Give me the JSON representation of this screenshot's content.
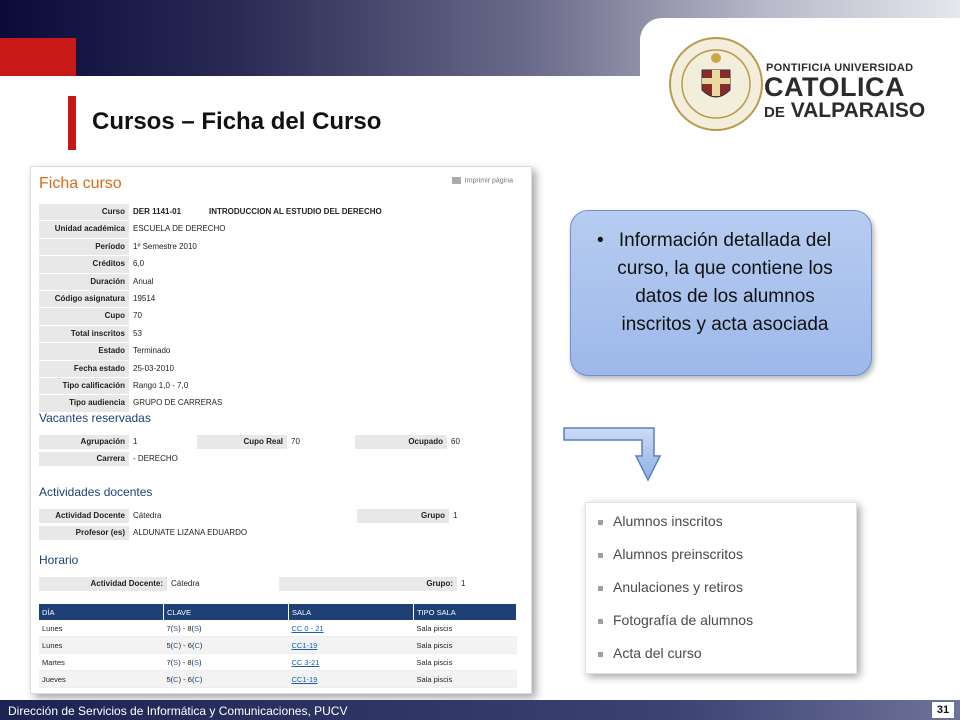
{
  "slide": {
    "title": "Cursos – Ficha del Curso",
    "university": {
      "l1": "PONTIFICIA UNIVERSIDAD",
      "l2": "CATOLICA",
      "l3a": "DE",
      "l3b": "VALPARAISO"
    },
    "footer": "Dirección de Servicios de Informática y Comunicaciones, PUCV",
    "page": "31"
  },
  "ficha": {
    "title": "Ficha curso",
    "print": "Imprimir página",
    "rows": [
      {
        "label": "Curso",
        "value": "DER 1141-01",
        "value2": "INTRODUCCION AL ESTUDIO DEL DERECHO"
      },
      {
        "label": "Unidad académica",
        "value": "ESCUELA DE DERECHO"
      },
      {
        "label": "Período",
        "value": "1º Semestre 2010"
      },
      {
        "label": "Créditos",
        "value": "6,0"
      },
      {
        "label": "Duración",
        "value": "Anual"
      },
      {
        "label": "Código asignatura",
        "value": "19514"
      },
      {
        "label": "Cupo",
        "value": "70"
      },
      {
        "label": "Total inscritos",
        "value": "53"
      },
      {
        "label": "Estado",
        "value": "Terminado"
      },
      {
        "label": "Fecha estado",
        "value": "25-03-2010"
      },
      {
        "label": "Tipo calificación",
        "value": "Rango 1,0 - 7,0"
      },
      {
        "label": "Tipo audiencia",
        "value": "GRUPO DE CARRERAS"
      }
    ],
    "vacantes": {
      "title": "Vacantes reservadas",
      "agrupacion_label": "Agrupación",
      "agrupacion": "1",
      "cupo_label": "Cupo Real",
      "cupo": "70",
      "ocupado_label": "Ocupado",
      "ocupado": "60",
      "carrera_label": "Carrera",
      "carrera": "- DERECHO"
    },
    "actividades": {
      "title": "Actividades docentes",
      "actividad_label": "Actividad Docente",
      "actividad": "Cátedra",
      "grupo_label": "Grupo",
      "grupo": "1",
      "profesor_label": "Profesor (es)",
      "profesor": "ALDUNATE LIZANA EDUARDO"
    },
    "horario": {
      "title": "Horario",
      "actividad_label": "Actividad Docente:",
      "actividad": "Cátedra",
      "grupo_label": "Grupo:",
      "grupo": "1",
      "columns": [
        "DÍA",
        "CLAVE",
        "SALA",
        "TIPO SALA"
      ],
      "rows": [
        {
          "dia": "Lunes",
          "c1": "7",
          "c1s": "S",
          "c2": "8",
          "c2s": "S",
          "sala": "CC 0 - 21",
          "tipo": "Sala piscis"
        },
        {
          "dia": "Lunes",
          "c1": "5",
          "c1s": "C",
          "c2": "6",
          "c2s": "C",
          "sala": "CC1-19",
          "tipo": "Sala piscis"
        },
        {
          "dia": "Martes",
          "c1": "7",
          "c1s": "S",
          "c2": "8",
          "c2s": "S",
          "sala": "CC 3-21",
          "tipo": "Sala piscis"
        },
        {
          "dia": "Jueves",
          "c1": "5",
          "c1s": "C",
          "c2": "6",
          "c2s": "C",
          "sala": "CC1-19",
          "tipo": "Sala piscis"
        }
      ]
    }
  },
  "bubble": {
    "text": "Información detallada del curso, la que contiene los datos de los alumnos inscritos y acta asociada",
    "bullet": "•"
  },
  "menu": [
    "Alumnos inscritos",
    "Alumnos preinscritos",
    "Anulaciones y retiros",
    "Fotografía de alumnos",
    "Acta del curso"
  ]
}
